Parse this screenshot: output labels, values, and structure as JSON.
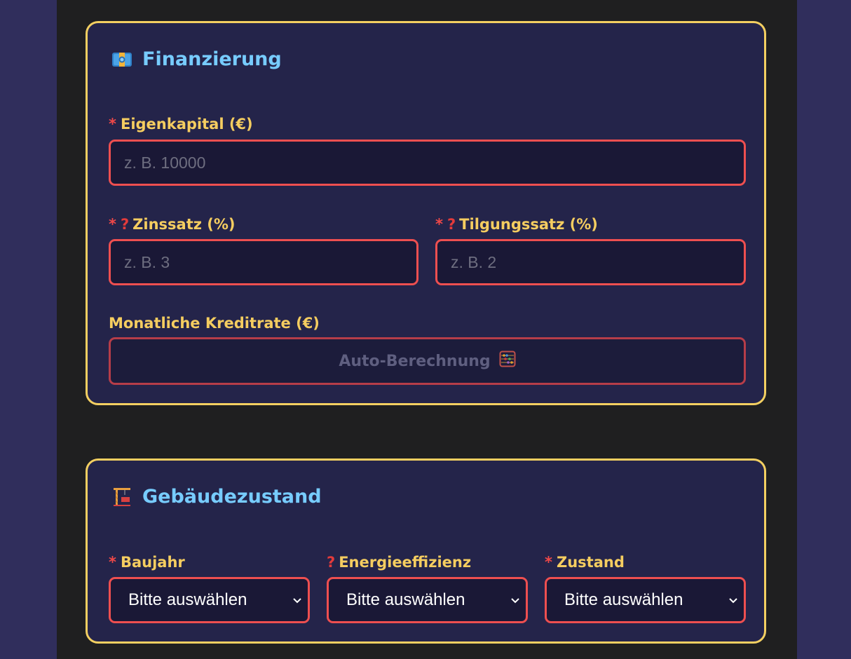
{
  "financing": {
    "icon": "money-banknote-icon",
    "title": "Finanzierung",
    "equity": {
      "required_mark": "*",
      "label": "Eigenkapital (€)",
      "placeholder": "z. B. 10000",
      "value": ""
    },
    "interest": {
      "required_mark": "*",
      "help_mark": "?",
      "label": "Zinssatz (%)",
      "placeholder": "z. B. 3",
      "value": ""
    },
    "repayment": {
      "required_mark": "*",
      "help_mark": "?",
      "label": "Tilgungssatz (%)",
      "placeholder": "z. B. 2",
      "value": ""
    },
    "monthly_rate": {
      "label": "Monatliche Kreditrate (€)",
      "auto_text": "Auto-Berechnung",
      "auto_icon": "abacus-icon"
    }
  },
  "building": {
    "icon": "building-construction-icon",
    "title": "Gebäudezustand",
    "year": {
      "required_mark": "*",
      "label": "Baujahr",
      "selected": "Bitte auswählen"
    },
    "energy": {
      "help_mark": "?",
      "label": "Energieeffizienz",
      "selected": "Bitte auswählen"
    },
    "condition": {
      "required_mark": "*",
      "label": "Zustand",
      "selected": "Bitte auswählen"
    }
  },
  "colors": {
    "card_border": "#f3cf61",
    "title": "#77ccff",
    "label": "#f5cd60",
    "input_border": "#ee4f50",
    "required": "#f04848"
  }
}
